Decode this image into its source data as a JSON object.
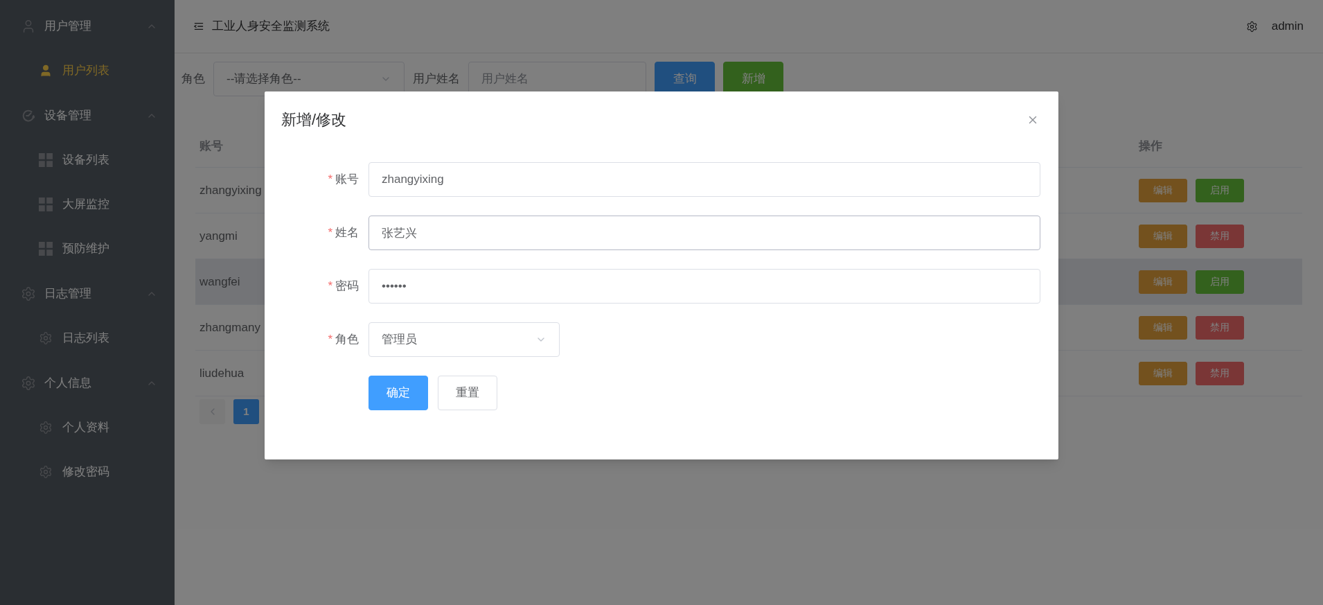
{
  "sidebar": {
    "groups": [
      {
        "label": "用户管理",
        "kind": "user",
        "expanded": true,
        "children": [
          {
            "label": "用户列表",
            "kind": "user",
            "selected": true
          }
        ]
      },
      {
        "label": "设备管理",
        "kind": "device",
        "expanded": true,
        "children": [
          {
            "label": "设备列表",
            "kind": "device",
            "selected": false
          },
          {
            "label": "大屏监控",
            "kind": "device",
            "selected": false
          },
          {
            "label": "预防维护",
            "kind": "device",
            "selected": false
          }
        ]
      },
      {
        "label": "日志管理",
        "kind": "log",
        "expanded": true,
        "children": [
          {
            "label": "日志列表",
            "kind": "log",
            "selected": false
          }
        ]
      },
      {
        "label": "个人信息",
        "kind": "log",
        "expanded": true,
        "children": [
          {
            "label": "个人资料",
            "kind": "log",
            "selected": false
          },
          {
            "label": "修改密码",
            "kind": "log",
            "selected": false
          }
        ]
      }
    ]
  },
  "header": {
    "title": "工业人身安全监测系统",
    "user": "admin"
  },
  "filter": {
    "role_label": "角色",
    "role_select": {
      "value": "--请选择角色--"
    },
    "name_label": "用户姓名",
    "name_field": {
      "placeholder": "用户姓名"
    },
    "buttons": [
      {
        "label": "查询",
        "kind": "primary"
      },
      {
        "label": "新增",
        "kind": "success"
      }
    ]
  },
  "table": {
    "columns": [
      "账号",
      "操作"
    ],
    "rows": [
      {
        "account": "zhangyixing",
        "hovered": false,
        "actions": [
          {
            "label": "编辑",
            "kind": "warning"
          },
          {
            "label": "启用",
            "kind": "success"
          }
        ]
      },
      {
        "account": "yangmi",
        "hovered": false,
        "actions": [
          {
            "label": "编辑",
            "kind": "warning"
          },
          {
            "label": "禁用",
            "kind": "danger"
          }
        ]
      },
      {
        "account": "wangfei",
        "hovered": true,
        "actions": [
          {
            "label": "编辑",
            "kind": "warning"
          },
          {
            "label": "启用",
            "kind": "success"
          }
        ]
      },
      {
        "account": "zhangmany",
        "hovered": false,
        "actions": [
          {
            "label": "编辑",
            "kind": "warning"
          },
          {
            "label": "禁用",
            "kind": "danger"
          }
        ]
      },
      {
        "account": "liudehua",
        "hovered": false,
        "actions": [
          {
            "label": "编辑",
            "kind": "warning"
          },
          {
            "label": "禁用",
            "kind": "danger"
          }
        ]
      }
    ]
  },
  "pagination": {
    "prev_disabled": true,
    "pages": [
      {
        "label": "1",
        "selected": true
      }
    ]
  },
  "dialog": {
    "title": "新增/修改",
    "fields": [
      {
        "label": "账号",
        "required_mark": "*",
        "kind": "text",
        "value": "zhangyixing",
        "focused": false
      },
      {
        "label": "姓名",
        "required_mark": "*",
        "kind": "text",
        "value": "张艺兴",
        "focused": true
      },
      {
        "label": "密码",
        "required_mark": "*",
        "kind": "text",
        "value": "••••••",
        "focused": false
      },
      {
        "label": "角色",
        "required_mark": "*",
        "kind": "select",
        "value": "管理员",
        "focused": false
      }
    ],
    "buttons": [
      {
        "label": "确定",
        "kind": "primary"
      },
      {
        "label": "重置",
        "kind": "default"
      }
    ]
  }
}
